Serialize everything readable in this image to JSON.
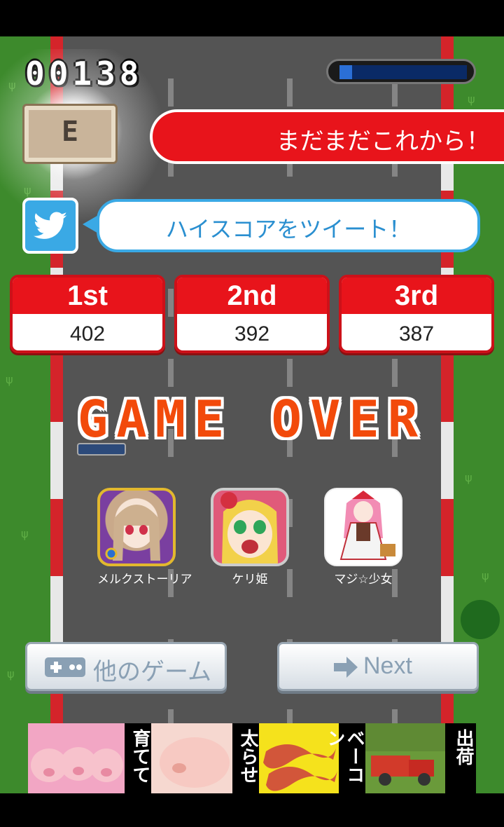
{
  "hud": {
    "score": "00138",
    "fuel_level": 0.1
  },
  "result": {
    "rank_letter": "E",
    "message": "まだまだこれから！"
  },
  "twitter": {
    "icon": "twitter-bird-icon",
    "tweet_label": "ハイスコアをツイート！"
  },
  "rankings": [
    {
      "label": "1st",
      "score": "402"
    },
    {
      "label": "2nd",
      "score": "392"
    },
    {
      "label": "3rd",
      "score": "387"
    }
  ],
  "game_over_text": "GAME OVER",
  "apps": [
    {
      "name": "メルクストーリア"
    },
    {
      "name": "ケリ姫"
    },
    {
      "name": "マジ☆少女"
    }
  ],
  "buttons": {
    "other_games_label": "他のゲーム",
    "other_games_icon": "gamepad-icon",
    "next_label": "Next",
    "next_icon": "arrow-right-icon"
  },
  "ad": {
    "step1": "育てて",
    "step2": "太らせ",
    "step3": "ベーコン",
    "step4": "出荷"
  },
  "colors": {
    "accent_red": "#e8141b",
    "game_over_orange": "#f24a0b",
    "twitter_blue": "#3aa9e5",
    "road_gray": "#545454",
    "grass_green": "#3d8a2c"
  }
}
